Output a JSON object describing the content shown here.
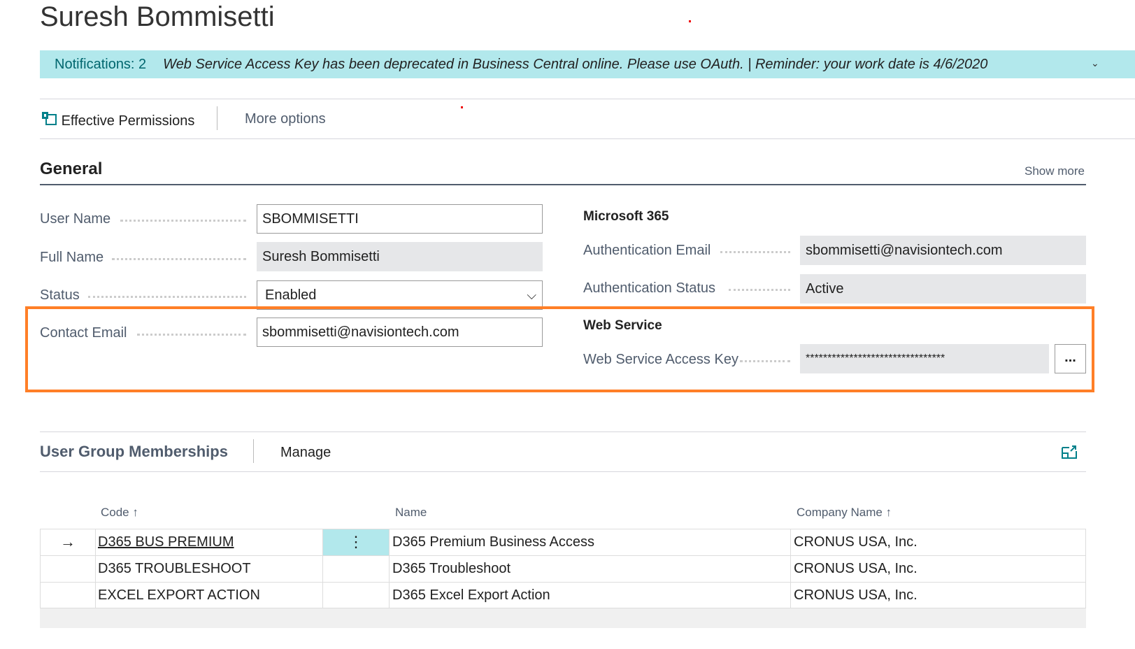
{
  "page_title": "Suresh Bommisetti",
  "notifications": {
    "count_label": "Notifications: 2",
    "message": "Web Service Access Key has been deprecated in Business Central online. Please use OAuth.  |  Reminder: your work date is 4/6/2020"
  },
  "actions": {
    "effective_permissions": "Effective Permissions",
    "more_options": "More options"
  },
  "general": {
    "title": "General",
    "show_more": "Show more",
    "user_name_label": "User Name",
    "user_name": "SBOMMISETTI",
    "full_name_label": "Full Name",
    "full_name": "Suresh Bommisetti",
    "status_label": "Status",
    "status": "Enabled",
    "contact_email_label": "Contact Email",
    "contact_email": "sbommisetti@navisiontech.com",
    "m365_title": "Microsoft 365",
    "auth_email_label": "Authentication Email",
    "auth_email": "sbommisetti@navisiontech.com",
    "auth_status_label": "Authentication Status",
    "auth_status": "Active",
    "ws_title": "Web Service",
    "ws_key_label": "Web Service Access Key",
    "ws_key": "********************************",
    "ws_assist": "..."
  },
  "highlight_color": "#ff7f27",
  "ugm": {
    "title": "User Group Memberships",
    "manage": "Manage",
    "columns": [
      "Code ↑",
      "Name",
      "Company Name ↑"
    ],
    "rows": [
      {
        "code": "D365 BUS PREMIUM",
        "name": "D365 Premium Business Access",
        "company": "CRONUS USA, Inc."
      },
      {
        "code": "D365 TROUBLESHOOT",
        "name": "D365 Troubleshoot",
        "company": "CRONUS USA, Inc."
      },
      {
        "code": "EXCEL EXPORT ACTION",
        "name": "D365 Excel Export Action",
        "company": "CRONUS USA, Inc."
      }
    ]
  }
}
